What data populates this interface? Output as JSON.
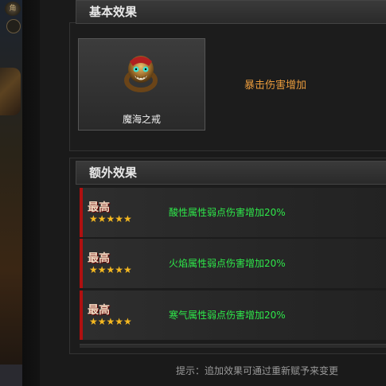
{
  "basic_section": {
    "title": "基本效果",
    "item_name": "魔海之戒",
    "effect": "暴击伤害增加"
  },
  "extra_section": {
    "title": "额外效果",
    "rows": [
      {
        "grade": "最高",
        "stars": "★★★★★",
        "effect": "酸性属性弱点伤害增加20%"
      },
      {
        "grade": "最高",
        "stars": "★★★★★",
        "effect": "火焰属性弱点伤害增加20%"
      },
      {
        "grade": "最高",
        "stars": "★★★★★",
        "effect": "寒气属性弱点伤害增加20%"
      }
    ]
  },
  "hint": "提示：追加效果可通过重新赋予来变更",
  "colors": {
    "effect_orange": "#e89a3c",
    "effect_green": "#2ee84a",
    "star_gold": "#f5b820",
    "grade_bar_red": "#b01010"
  },
  "icons": {
    "item": "demon-ring-icon",
    "star": "star-icon"
  }
}
